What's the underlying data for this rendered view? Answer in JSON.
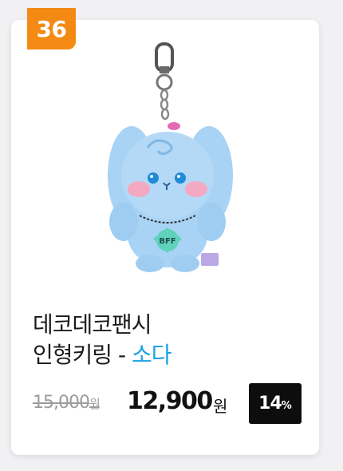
{
  "product": {
    "rank": "36",
    "image_alt_icon": "plush-keyring-image",
    "title_line1": "데코데코팬시",
    "title_line2_prefix": "인형키링 - ",
    "title_variant": "소다",
    "original_price": "15,000",
    "original_price_unit": "원",
    "sale_price": "12,900",
    "sale_price_unit": "원",
    "discount_value": "14",
    "discount_unit": "%"
  },
  "colors": {
    "rank_badge": "#f48a13",
    "variant_text": "#1aa0e6",
    "discount_badge": "#0d0d0d",
    "plush_body": "#a9d3f5"
  }
}
